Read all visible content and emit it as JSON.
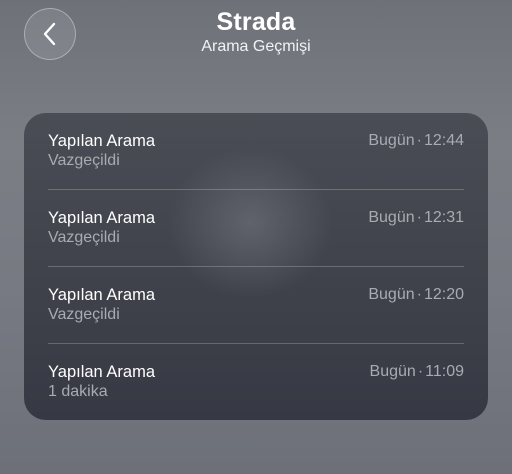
{
  "header": {
    "title": "Strada",
    "subtitle": "Arama Geçmişi",
    "back_icon": "chevron-left-icon"
  },
  "calls": [
    {
      "type": "Yapılan Arama",
      "status": "Vazgeçildi",
      "day": "Bugün",
      "separator": "·",
      "time": "12:44"
    },
    {
      "type": "Yapılan Arama",
      "status": "Vazgeçildi",
      "day": "Bugün",
      "separator": "·",
      "time": "12:31"
    },
    {
      "type": "Yapılan Arama",
      "status": "Vazgeçildi",
      "day": "Bugün",
      "separator": "·",
      "time": "12:20"
    },
    {
      "type": "Yapılan Arama",
      "status": "1 dakika",
      "day": "Bugün",
      "separator": "·",
      "time": "11:09"
    }
  ]
}
